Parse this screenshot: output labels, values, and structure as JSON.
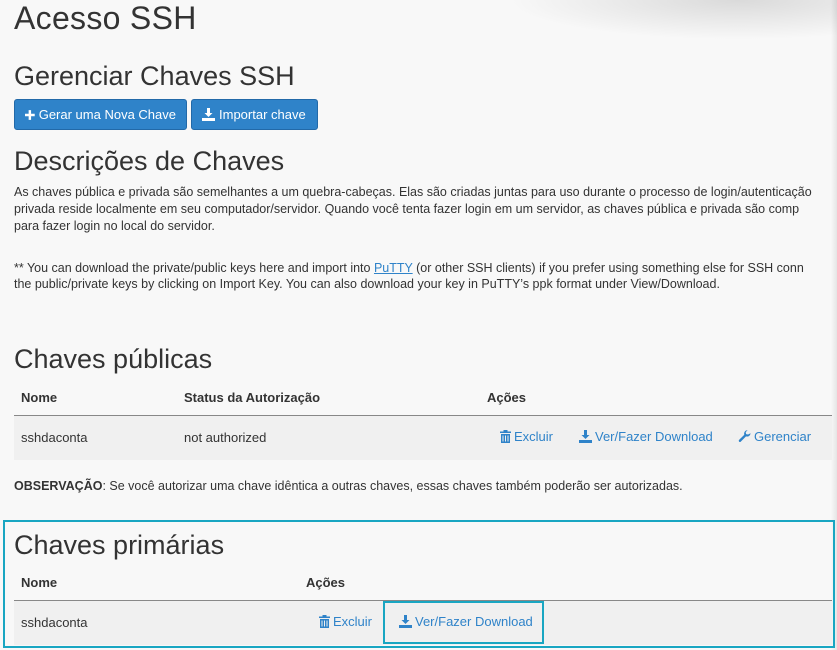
{
  "page_title": "Acesso SSH",
  "manage": {
    "heading": "Gerenciar Chaves SSH",
    "generate_button": "Gerar uma Nova Chave",
    "import_button": "Importar chave"
  },
  "descriptions": {
    "heading": "Descrições de Chaves",
    "paragraph_lines": [
      "As chaves pública e privada são semelhantes a um quebra-cabeças. Elas são criadas juntas para uso durante o processo de login/autenticação",
      "privada reside localmente em seu computador/servidor. Quando você tenta fazer login em um servidor, as chaves pública e privada são comp",
      "para fazer login no local do servidor."
    ],
    "note_line1_before": "** You can download the private/public keys here and import into ",
    "note_link": "PuTTY",
    "note_line1_after": " (or other SSH clients) if you prefer using something else for SSH conn",
    "note_line2": "the public/private keys by clicking on Import Key. You can also download your key in PuTTY’s ppk format under View/Download."
  },
  "public_keys": {
    "heading": "Chaves públicas",
    "columns": [
      "Nome",
      "Status da Autorização",
      "Ações"
    ],
    "rows": [
      {
        "name": "sshdaconta",
        "status": "not authorized",
        "delete": "Excluir",
        "download": "Ver/Fazer Download",
        "manage": "Gerenciar"
      }
    ]
  },
  "observation": {
    "label": "OBSERVAÇÃO",
    "text": ": Se você autorizar uma chave idêntica a outras chaves, essas chaves também poderão ser autorizadas."
  },
  "private_keys": {
    "heading": "Chaves primárias",
    "columns": [
      "Nome",
      "Ações"
    ],
    "rows": [
      {
        "name": "sshdaconta",
        "delete": "Excluir",
        "download": "Ver/Fazer Download"
      }
    ]
  },
  "colors": {
    "accent": "#2f83c9",
    "highlight": "#19a6c2",
    "background": "#f8f8f8"
  },
  "icons": [
    "plus-icon",
    "import-icon",
    "trash-icon",
    "download-icon",
    "wrench-icon"
  ]
}
